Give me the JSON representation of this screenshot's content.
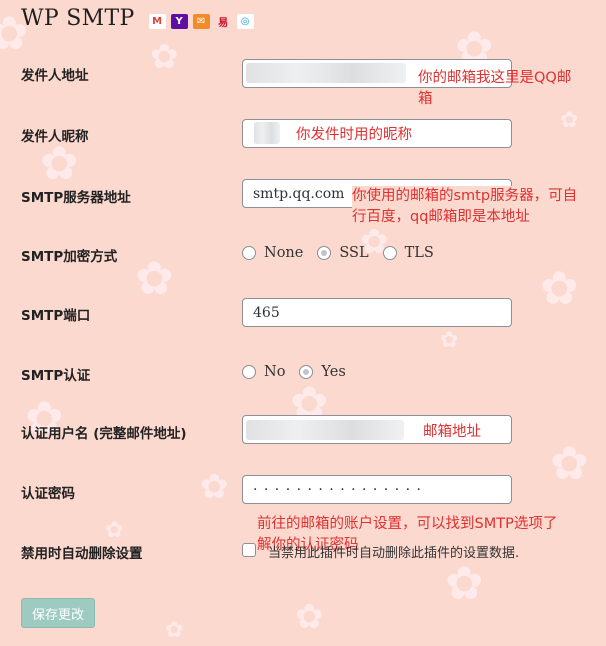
{
  "page": {
    "title": "WP SMTP",
    "share_icons": [
      {
        "name": "gmail-icon",
        "glyph": "M",
        "color": "#d44638",
        "bg": "#ffffff"
      },
      {
        "name": "yahoo-icon",
        "glyph": "Y",
        "color": "#ffffff",
        "bg": "#5f0ea3"
      },
      {
        "name": "mail-icon",
        "glyph": "✉",
        "color": "#ffffff",
        "bg": "#f28c28"
      },
      {
        "name": "sina-weibo-icon",
        "glyph": "易",
        "color": "#c8102e",
        "bg": "#fbd9cf"
      },
      {
        "name": "qq-icon",
        "glyph": "◎",
        "color": "#1aa0e6",
        "bg": "#ffffff"
      }
    ]
  },
  "fields": {
    "from_address": {
      "label": "发件人地址",
      "value": ""
    },
    "from_name": {
      "label": "发件人昵称",
      "value": ""
    },
    "smtp_host": {
      "label": "SMTP服务器地址",
      "value": "smtp.qq.com"
    },
    "smtp_secure": {
      "label": "SMTP加密方式",
      "options": [
        "None",
        "SSL",
        "TLS"
      ],
      "selected": "SSL"
    },
    "smtp_port": {
      "label": "SMTP端口",
      "value": "465"
    },
    "smtp_auth": {
      "label": "SMTP认证",
      "options": [
        "No",
        "Yes"
      ],
      "selected": "Yes"
    },
    "username": {
      "label": "认证用户名 (完整邮件地址)",
      "value": ""
    },
    "password": {
      "label": "认证密码",
      "value": "· · · · · · · · · · · · · · · ·"
    },
    "delete_on_disable": {
      "label": "禁用时自动删除设置",
      "checkbox_label": "当禁用此插件时自动删除此插件的设置数据.",
      "checked": false
    }
  },
  "annotations": {
    "from_address": [
      "你的邮箱我这里是QQ邮",
      "箱"
    ],
    "from_name": "你发件时用的昵称",
    "smtp_host": [
      "你使用的邮箱的smtp服务器，可自",
      "行百度，qq邮箱即是本地址"
    ],
    "username": "邮箱地址",
    "password": [
      "前往的邮箱的账户设置，可以找到SMTP选项了",
      "解你的认证密码"
    ]
  },
  "actions": {
    "save_label": "保存更改"
  },
  "colors": {
    "background": "#fbd9cf",
    "annotation": "#e03030",
    "button": "#9ecbc1"
  }
}
